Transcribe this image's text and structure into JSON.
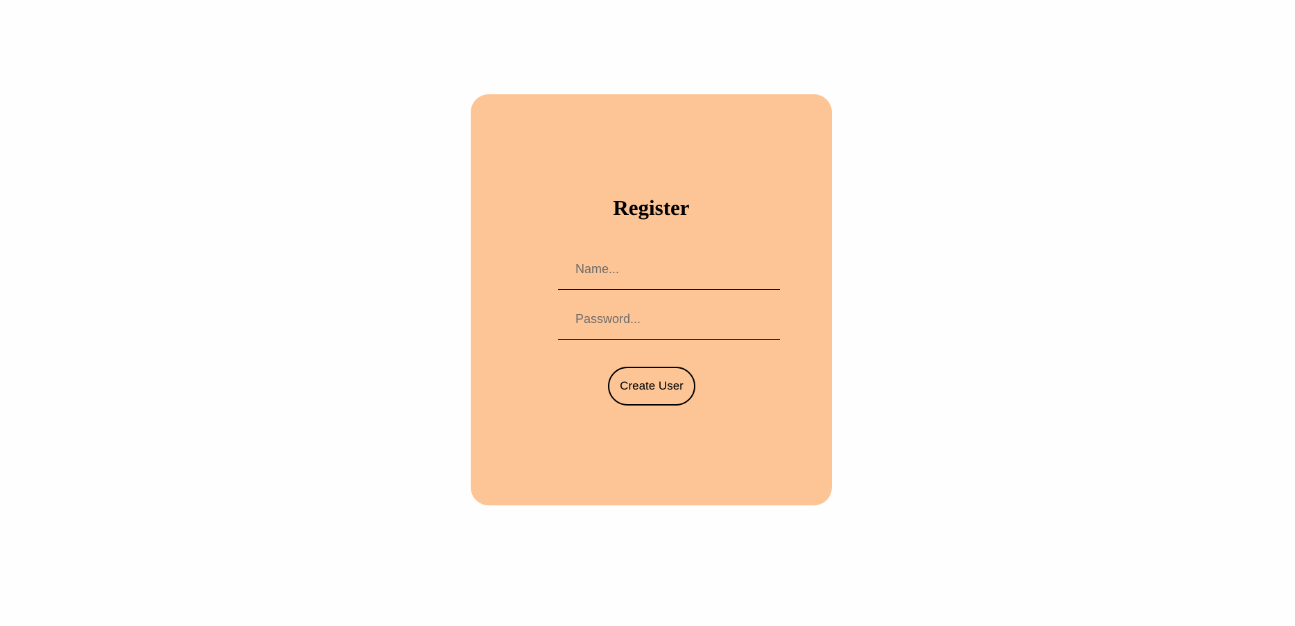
{
  "page": {
    "background": "#fefefe"
  },
  "register_card": {
    "background": "#fdc596",
    "title": "Register",
    "name_field": {
      "placeholder": "Name...",
      "value": ""
    },
    "password_field": {
      "placeholder": "Password...",
      "value": ""
    },
    "submit_label": "Create User"
  }
}
